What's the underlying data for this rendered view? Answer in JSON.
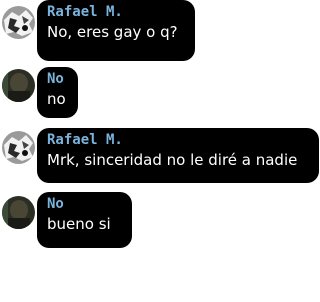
{
  "colors": {
    "bubble_bg": "#000000",
    "sender_name": "#7ab3dc",
    "message_text": "#ffffff",
    "page_bg": "#ffffff"
  },
  "messages": [
    {
      "sender": "Rafael M.",
      "text": "No, eres gay o q?",
      "avatar": "bw-photo-avatar"
    },
    {
      "sender": "No",
      "text": "no",
      "avatar": "dark-photo-avatar"
    },
    {
      "sender": "Rafael M.",
      "text": "Mrk, sinceridad no le diré a nadie",
      "avatar": "bw-photo-avatar"
    },
    {
      "sender": "No",
      "text": "bueno si",
      "avatar": "dark-photo-avatar"
    }
  ]
}
